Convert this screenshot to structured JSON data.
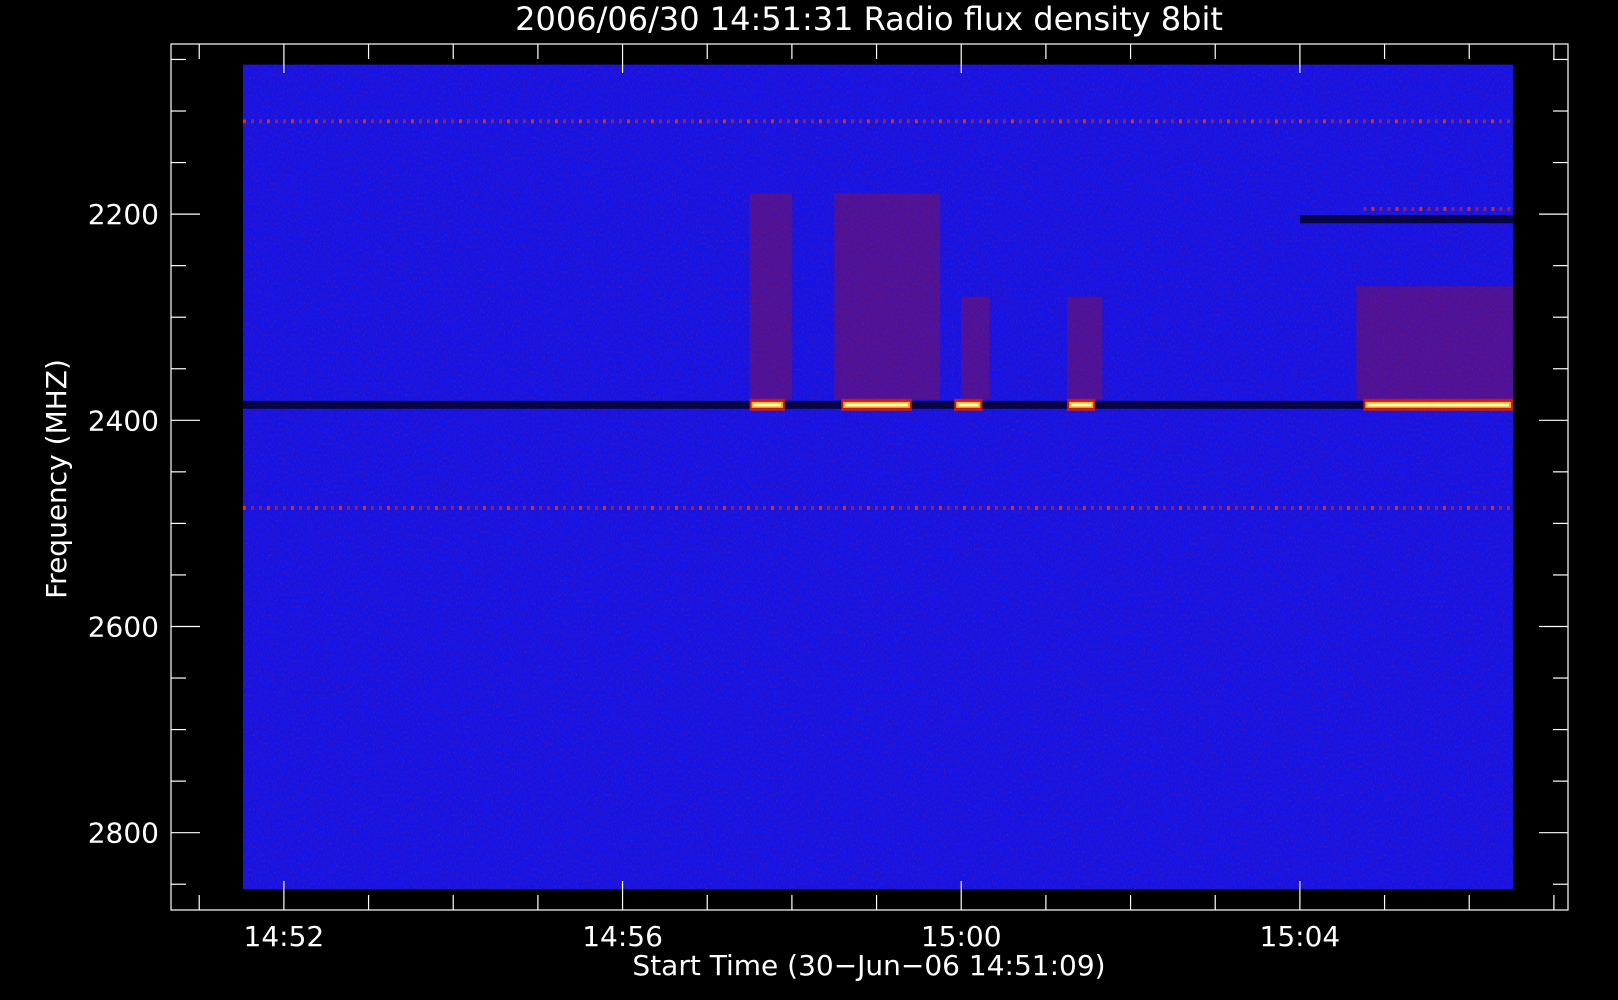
{
  "chart_data": {
    "type": "heatmap",
    "title": "2006/06/30 14:51:31 Radio flux density 8bit",
    "xlabel": "Start Time (30−Jun−06 14:51:09)",
    "ylabel": "Frequency (MHZ)",
    "x_axis": {
      "unit": "time",
      "range": [
        "14:50:40",
        "15:07:10"
      ],
      "data_extent": [
        "14:51:31",
        "15:06:31"
      ],
      "major_ticks": [
        "14:52",
        "14:56",
        "15:00",
        "15:04"
      ],
      "minor_tick_interval_minutes": 1
    },
    "y_axis": {
      "unit": "MHz",
      "inverted": true,
      "range": [
        2035,
        2875
      ],
      "data_extent": [
        2055,
        2855
      ],
      "major_ticks": [
        2200,
        2400,
        2600,
        2800
      ],
      "minor_tick_interval": 50
    },
    "colormap": {
      "background": "#1414e6",
      "low": "#000010",
      "mid": "#c01000",
      "high": "#ffffc0"
    },
    "features": [
      {
        "type": "band",
        "freq_mhz": 2385,
        "start": "14:51:31",
        "end": "15:06:31",
        "level": "low",
        "note": "dark absorption line"
      },
      {
        "type": "band",
        "freq_mhz": 2485,
        "start": "14:51:31",
        "end": "15:06:31",
        "level": "mid",
        "note": "dotted interference line"
      },
      {
        "type": "band",
        "freq_mhz": 2110,
        "start": "14:51:31",
        "end": "15:06:31",
        "level": "mid",
        "note": "dotted interference line"
      },
      {
        "type": "burst",
        "freq_mhz": 2385,
        "start": "14:57:30",
        "end": "14:57:55",
        "level": "high"
      },
      {
        "type": "burst",
        "freq_mhz": 2385,
        "start": "14:58:35",
        "end": "14:59:25",
        "level": "high"
      },
      {
        "type": "burst",
        "freq_mhz": 2385,
        "start": "14:59:55",
        "end": "15:00:15",
        "level": "high"
      },
      {
        "type": "burst",
        "freq_mhz": 2385,
        "start": "15:01:15",
        "end": "15:01:35",
        "level": "high"
      },
      {
        "type": "burst",
        "freq_mhz": 2385,
        "start": "15:04:45",
        "end": "15:06:31",
        "level": "high"
      },
      {
        "type": "patch",
        "freq_range": [
          2180,
          2380
        ],
        "start": "14:57:30",
        "end": "14:58:00",
        "level": "mid"
      },
      {
        "type": "patch",
        "freq_range": [
          2180,
          2380
        ],
        "start": "14:58:30",
        "end": "14:59:45",
        "level": "mid"
      },
      {
        "type": "patch",
        "freq_range": [
          2280,
          2380
        ],
        "start": "15:00:00",
        "end": "15:00:20",
        "level": "mid"
      },
      {
        "type": "patch",
        "freq_range": [
          2280,
          2380
        ],
        "start": "15:01:15",
        "end": "15:01:40",
        "level": "mid"
      },
      {
        "type": "patch",
        "freq_range": [
          2270,
          2380
        ],
        "start": "15:04:40",
        "end": "15:06:31",
        "level": "mid"
      },
      {
        "type": "band",
        "freq_mhz": 2195,
        "start": "15:04:45",
        "end": "15:06:31",
        "level": "mid"
      },
      {
        "type": "band",
        "freq_mhz": 2205,
        "start": "15:04:00",
        "end": "15:06:31",
        "level": "low"
      }
    ]
  }
}
